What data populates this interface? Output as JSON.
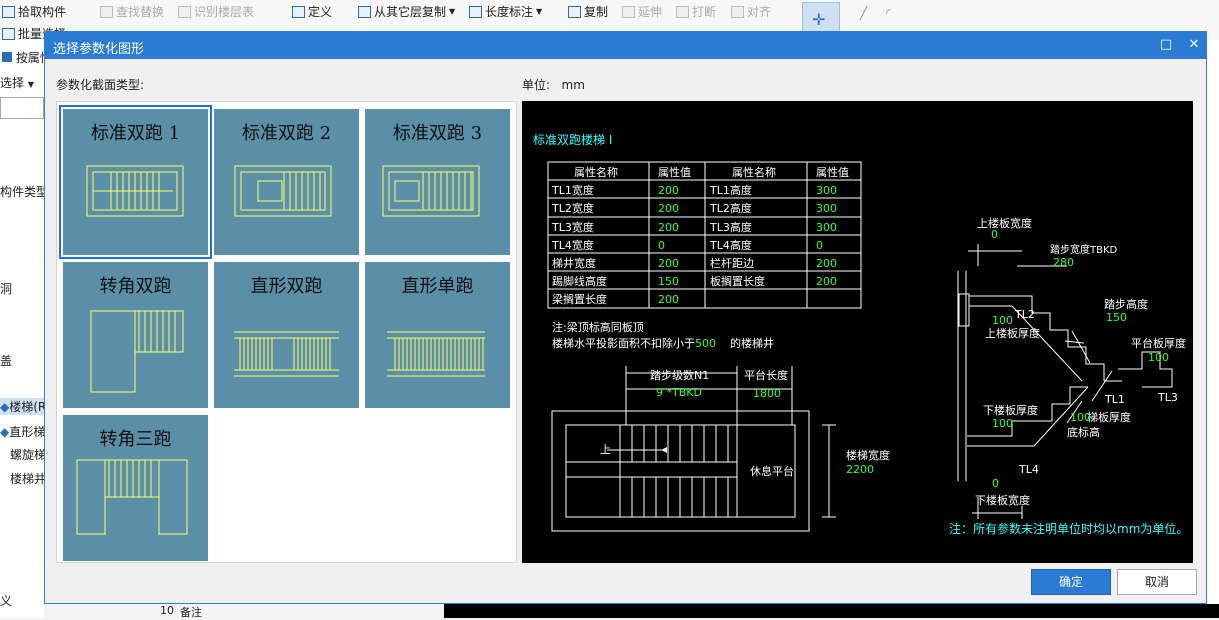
{
  "toolbar": {
    "pick": "拾取构件",
    "find_replace": "查找替换",
    "identify_floor": "识别楼层表",
    "define": "定义",
    "copy_from_floor": "从其它层复制",
    "length_mark": "长度标注",
    "copy": "复制",
    "extend": "延伸",
    "break": "打断",
    "align": "对齐",
    "batch": "批量选择",
    "by_attr": "按属性",
    "select": "选择"
  },
  "left_panel": {
    "component_type": "构件类型",
    "item_a": "洞",
    "item_b": "盖",
    "stair": "楼梯(R",
    "straight": "直形梯",
    "spiral": "螺旋梯",
    "well": "楼梯井",
    "row_no": "10",
    "row_label": "备注",
    "bottom": "义"
  },
  "dialog": {
    "title": "选择参数化图形",
    "type_label": "参数化截面类型:",
    "unit_label": "单位:",
    "unit_value": "mm",
    "ok": "确定",
    "cancel": "取消",
    "shapes": [
      {
        "label": "标准双跑 1"
      },
      {
        "label": "标准双跑 2"
      },
      {
        "label": "标准双跑 3"
      },
      {
        "label": "转角双跑"
      },
      {
        "label": "直形双跑"
      },
      {
        "label": "直形单跑"
      },
      {
        "label": "转角三跑"
      }
    ]
  },
  "preview": {
    "heading": "标准双跑楼梯 I",
    "table_headers": [
      "属性名称",
      "属性值",
      "属性名称",
      "属性值"
    ],
    "table_rows": [
      [
        "TL1宽度",
        "200",
        "TL1高度",
        "300"
      ],
      [
        "TL2宽度",
        "200",
        "TL2高度",
        "300"
      ],
      [
        "TL3宽度",
        "200",
        "TL3高度",
        "300"
      ],
      [
        "TL4宽度",
        "0",
        "TL4高度",
        "0"
      ],
      [
        "梯井宽度",
        "200",
        "栏杆距边",
        "200"
      ],
      [
        "踢脚线高度",
        "150",
        "板搁置长度",
        "200"
      ],
      [
        "梁搁置长度",
        "200",
        "",
        ""
      ]
    ],
    "note1": "注:梁顶标高同板顶",
    "note2a": "楼梯水平投影面积不扣除小于",
    "note2b": "500",
    "note2c": "的楼梯井",
    "plan": {
      "step_count_label": "踏步级数N1",
      "step_count_value": "9 *TBKD",
      "platform_len_label": "平台长度",
      "platform_len_value": "1800",
      "stair_width_label": "楼梯宽度",
      "stair_width_value": "2200",
      "up": "上",
      "rest_platform": "休息平台"
    },
    "section": {
      "top_slab_width": "上楼板宽度",
      "top_slab_width_val": "0",
      "tread_width": "踏步宽度TBKD",
      "tread_width_val": "280",
      "tread_height": "踏步高度",
      "tread_height_val": "150",
      "tl2": "TL2",
      "top_slab_thk": "上楼板厚度",
      "platform_thk": "平台板厚度",
      "platform_thk_val": "100",
      "tl1": "TL1",
      "tl3": "TL3",
      "bot_slab_thk": "下楼板厚度",
      "bot_slab_thk_val": "100",
      "slab_thk": "梯板厚度",
      "slab_thk_val": "100",
      "bottom_elev": "底标高",
      "tl4": "TL4",
      "bot_slab_width_val": "0",
      "bot_slab_width": "下楼板宽度",
      "top_slab_thk_val": "100"
    },
    "footer": "注：所有参数未注明单位时均以mm为单位。"
  },
  "colors": {
    "accent": "#2b7ad4",
    "cell_bg": "#5b8fa8",
    "cad_yellow": "#ffff66",
    "cad_green": "#33ff33",
    "cad_cyan": "#33ffff"
  }
}
